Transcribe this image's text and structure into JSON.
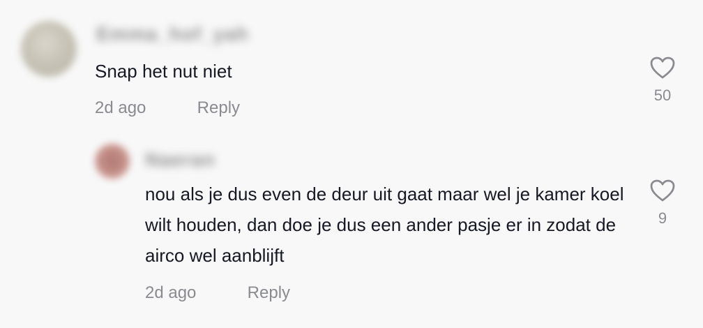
{
  "comment": {
    "username": "Emma_hof_yah",
    "text": "Snap het nut niet",
    "time": "2d ago",
    "reply_label": "Reply",
    "like_count": "50",
    "reply": {
      "username": "Naeran",
      "text": "nou als je dus even de deur uit gaat maar wel je kamer koel wilt houden, dan doe je dus een ander pasje er in zodat de airco wel aanblijft",
      "time": "2d ago",
      "reply_label": "Reply",
      "like_count": "9"
    }
  },
  "icons": {
    "like": "heart-outline-icon"
  },
  "colors": {
    "background": "#f8f8f8",
    "text": "#161823",
    "secondary_text": "#8a8b91"
  }
}
